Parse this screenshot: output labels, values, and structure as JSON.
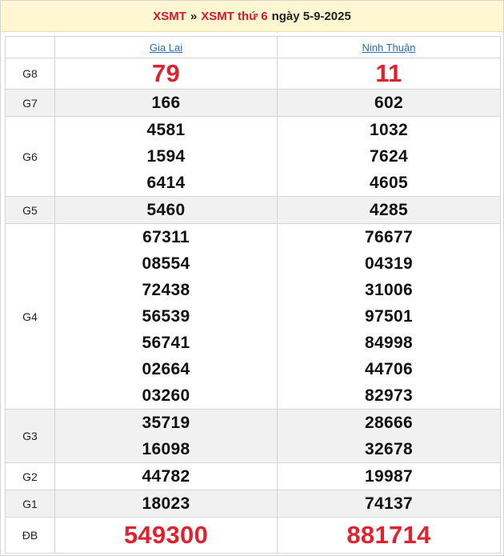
{
  "title": {
    "part1": "XSMT",
    "separator": "»",
    "part2": "XSMT thứ 6",
    "date": "ngày 5-9-2025"
  },
  "provinces": [
    "Gia Lai",
    "Ninh Thuận"
  ],
  "prizes": [
    {
      "label": "G8",
      "results": [
        [
          "79"
        ],
        [
          "11"
        ]
      ]
    },
    {
      "label": "G7",
      "results": [
        [
          "166"
        ],
        [
          "602"
        ]
      ]
    },
    {
      "label": "G6",
      "results": [
        [
          "4581",
          "1594",
          "6414"
        ],
        [
          "1032",
          "7624",
          "4605"
        ]
      ]
    },
    {
      "label": "G5",
      "results": [
        [
          "5460"
        ],
        [
          "4285"
        ]
      ]
    },
    {
      "label": "G4",
      "results": [
        [
          "67311",
          "08554",
          "72438",
          "56539",
          "56741",
          "02664",
          "03260"
        ],
        [
          "76677",
          "04319",
          "31006",
          "97501",
          "84998",
          "44706",
          "82973"
        ]
      ]
    },
    {
      "label": "G3",
      "results": [
        [
          "35719",
          "16098"
        ],
        [
          "28666",
          "32678"
        ]
      ]
    },
    {
      "label": "G2",
      "results": [
        [
          "44782"
        ],
        [
          "19987"
        ]
      ]
    },
    {
      "label": "G1",
      "results": [
        [
          "18023"
        ],
        [
          "74137"
        ]
      ]
    },
    {
      "label": "ĐB",
      "results": [
        [
          "549300"
        ],
        [
          "881714"
        ]
      ]
    }
  ],
  "colors": {
    "accent_red": "#e0222e",
    "link_blue": "#2a6cb5",
    "header_bg": "#fff7d2",
    "alt_row_bg": "#f1f1f1"
  }
}
